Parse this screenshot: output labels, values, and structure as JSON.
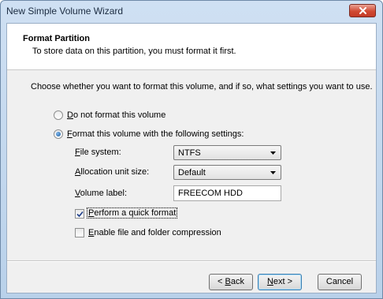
{
  "window": {
    "title": "New Simple Volume Wizard",
    "close_icon": "close-icon"
  },
  "header": {
    "title": "Format Partition",
    "subtitle": "To store data on this partition, you must format it first."
  },
  "prompt": "Choose whether you want to format this volume, and if so, what settings you want to use.",
  "options": {
    "no_format": {
      "label_prefix": "",
      "mnemonic": "D",
      "label_rest": "o not format this volume",
      "selected": false
    },
    "format": {
      "label_prefix": "",
      "mnemonic": "F",
      "label_rest": "ormat this volume with the following settings:",
      "selected": true
    }
  },
  "settings": {
    "file_system": {
      "mnemonic": "F",
      "label_rest": "ile system:",
      "value": "NTFS"
    },
    "allocation": {
      "mnemonic": "A",
      "label_rest": "llocation unit size:",
      "value": "Default"
    },
    "volume_label": {
      "mnemonic": "V",
      "label_rest": "olume label:",
      "value": "FREECOM HDD"
    }
  },
  "checks": {
    "quick_format": {
      "mnemonic": "P",
      "label_rest": "erform a quick format",
      "checked": true
    },
    "compression": {
      "mnemonic": "E",
      "label_rest": "nable file and folder compression",
      "checked": false
    }
  },
  "buttons": {
    "back": {
      "prefix": "< ",
      "mnemonic": "B",
      "rest": "ack"
    },
    "next": {
      "prefix": "",
      "mnemonic": "N",
      "rest": "ext >"
    },
    "cancel": {
      "label": "Cancel"
    }
  },
  "colors": {
    "title_bar": "#c4d9f0",
    "close": "#c9432d",
    "client": "#f0f0f0",
    "default_button_border": "#3c7fb1"
  }
}
